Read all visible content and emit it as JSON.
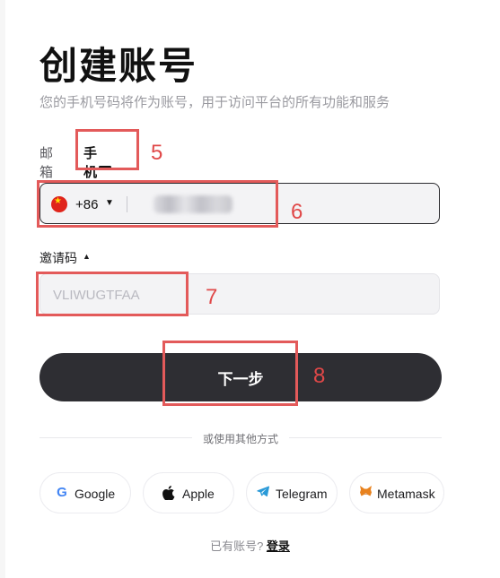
{
  "page": {
    "title": "创建账号",
    "subtitle": "您的手机号码将作为账号，用于访问平台的所有功能和服务"
  },
  "tabs": [
    {
      "label": "邮箱",
      "active": false
    },
    {
      "label": "手机号",
      "active": true
    }
  ],
  "phone": {
    "flag": "china-flag",
    "country_code": "+86",
    "number": "(blurred)"
  },
  "invite": {
    "label": "邀请码",
    "value": "VLIWUGTFAA"
  },
  "next_button": {
    "label": "下一步"
  },
  "divider_text": "或使用其他方式",
  "social_logins": [
    {
      "label": "Google",
      "icon": "google-icon"
    },
    {
      "label": "Apple",
      "icon": "apple-icon"
    },
    {
      "label": "Telegram",
      "icon": "telegram-icon"
    },
    {
      "label": "Metamask",
      "icon": "metamask-icon"
    }
  ],
  "login": {
    "prompt": "已有账号?",
    "link": "登录"
  },
  "annotations": {
    "n5": "5",
    "n6": "6",
    "n7": "7",
    "n8": "8"
  },
  "colors": {
    "accent": "#2e2e33",
    "annotation": "#e35a5a"
  }
}
